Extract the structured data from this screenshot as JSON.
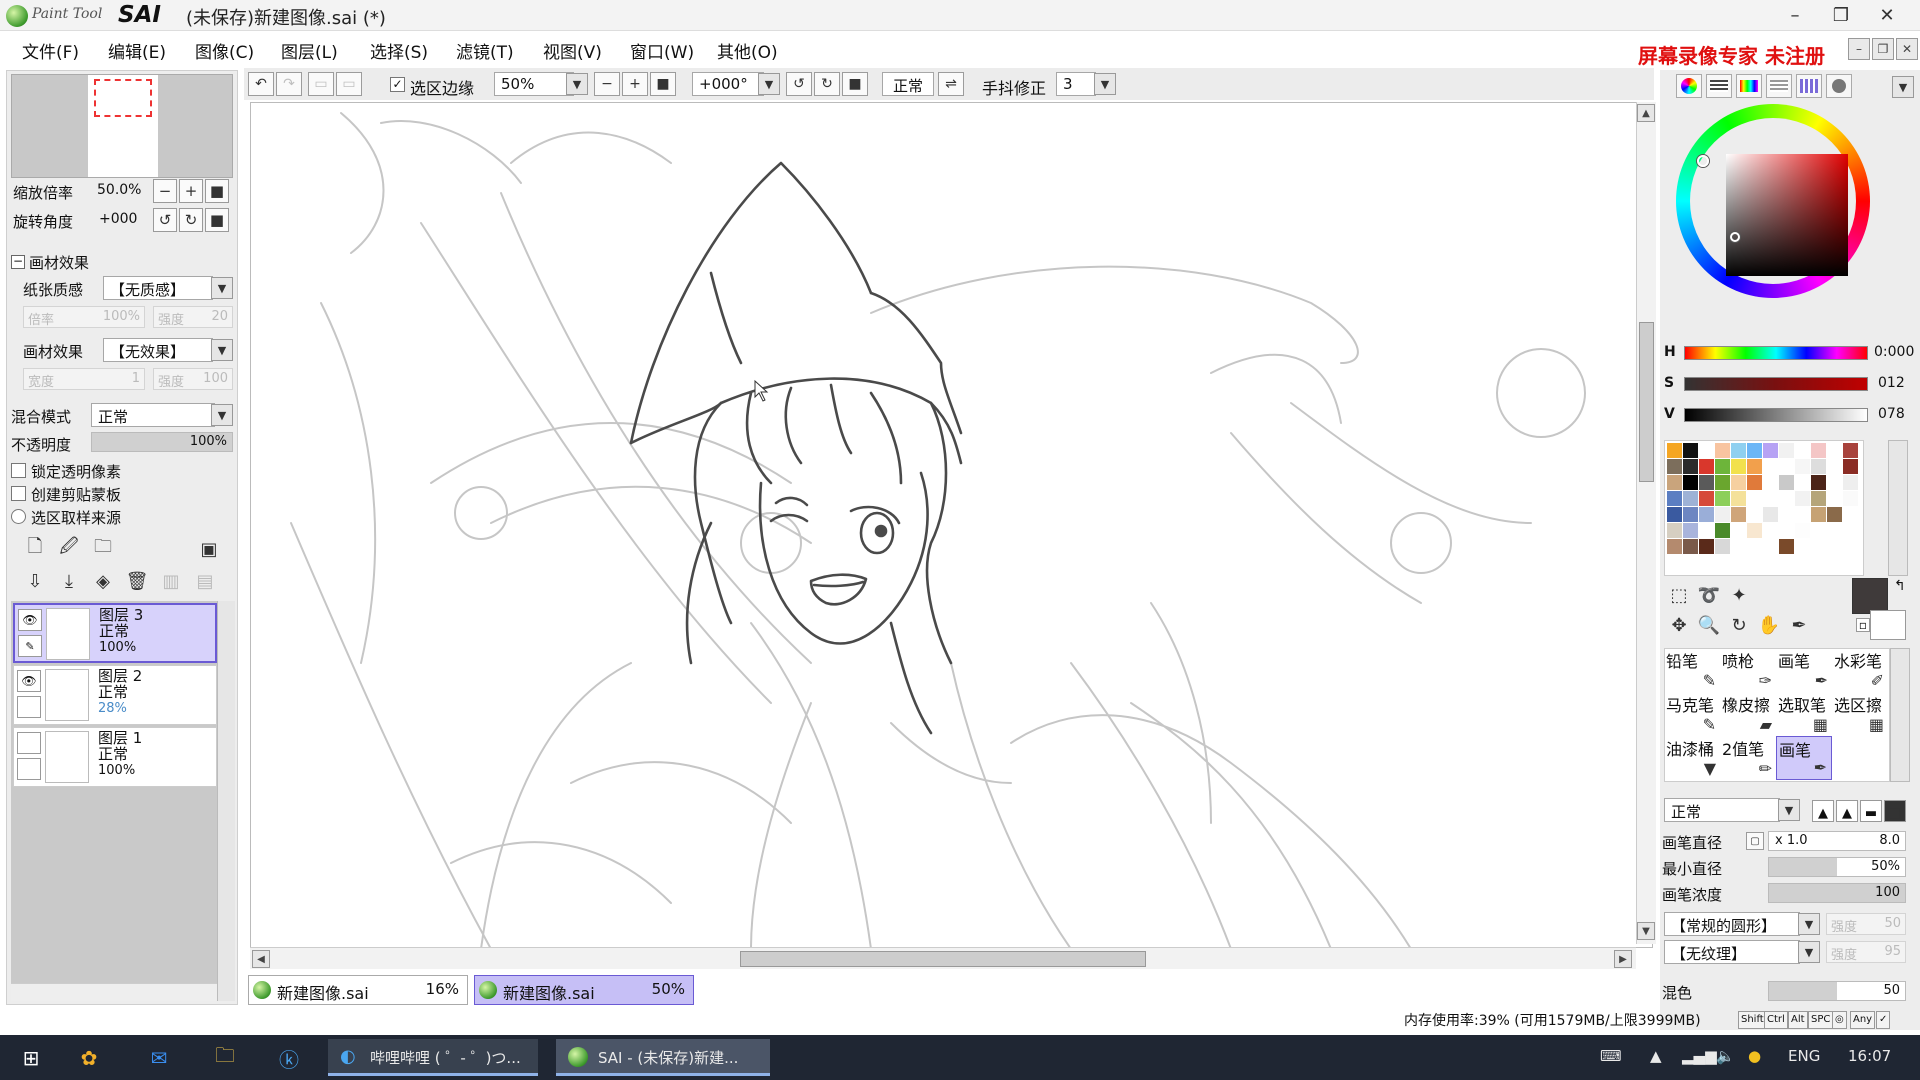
{
  "titlebar": {
    "logo_small": "Paint Tool",
    "logo_big": "SAI",
    "title": "(未保存)新建图像.sai (*)",
    "minimize_icon": "minimize-icon",
    "restore_icon": "restore-icon",
    "close_icon": "close-icon"
  },
  "menu": [
    "文件(F)",
    "编辑(E)",
    "图像(C)",
    "图层(L)",
    "选择(S)",
    "滤镜(T)",
    "视图(V)",
    "窗口(W)",
    "其他(O)"
  ],
  "watermark": "屏幕录像专家 未注册",
  "navigator": {
    "zoom_label": "缩放倍率",
    "zoom_value": "50.0%",
    "rotate_label": "旋转角度",
    "rotate_value": "+000"
  },
  "texture": {
    "section_label": "画材效果",
    "paper_label": "纸张质感",
    "paper_value": "【无质感】",
    "scale_label": "倍率",
    "scale_value": "100%",
    "strength_label": "强度",
    "strength_value": "20",
    "effect_label": "画材效果",
    "effect_value": "【无效果】",
    "width_label": "宽度",
    "width_value": "1",
    "strength2_label": "强度",
    "strength2_value": "100"
  },
  "layer_props": {
    "blend_label": "混合模式",
    "blend_value": "正常",
    "opacity_label": "不透明度",
    "opacity_value": "100%",
    "opacity_fraction": 1.0,
    "lock_transparency": "锁定透明像素",
    "clipping_group": "创建剪贴蒙板",
    "selection_source": "选区取样来源"
  },
  "layers": [
    {
      "name": "图层 3",
      "mode": "正常",
      "opacity": "100%",
      "visible": true,
      "selected": true
    },
    {
      "name": "图层 2",
      "mode": "正常",
      "opacity": "28%",
      "visible": true,
      "selected": false
    },
    {
      "name": "图层 1",
      "mode": "正常",
      "opacity": "100%",
      "visible": false,
      "selected": false
    }
  ],
  "toolbar": {
    "show_selection": "选区边缘",
    "zoom": "50%",
    "rotation": "+000°",
    "blend": "正常",
    "stabilizer_label": "手抖修正",
    "stabilizer_value": "3"
  },
  "doc_tabs": [
    {
      "name": "新建图像.sai",
      "zoom": "16%",
      "active": false
    },
    {
      "name": "新建图像.sai",
      "zoom": "50%",
      "active": true
    }
  ],
  "color": {
    "h_label": "H",
    "h_value": "0:000",
    "s_label": "S",
    "s_value": "012",
    "v_label": "V",
    "v_value": "078",
    "primary_color": "#3f3a3a",
    "secondary_color": "#ffffff"
  },
  "swatches": [
    "#f5a623",
    "#111111",
    "#ffffff",
    "#f8c4a0",
    "#8fd0f0",
    "#6cb6f6",
    "#b6a2f4",
    "#f1f1f1",
    "#ffffff",
    "#f4c6c6",
    "#ffffff",
    "#a8423c",
    "#7c6e5c",
    "#2b2b2b",
    "#d9372c",
    "#6db53a",
    "#f2e14d",
    "#f2a04c",
    "#ffffff",
    "#ffffff",
    "#f6f6f6",
    "#dddddd",
    "#ffffff",
    "#8a2c24",
    "#c9a47c",
    "#000000",
    "#5a5a5a",
    "#6aa62e",
    "#f6d0a0",
    "#e07a3a",
    "#ffffff",
    "#c9c9c9",
    "#ffffff",
    "#4c2418",
    "#ffffff",
    "#eeeeee",
    "#5b7ec2",
    "#9eb2d6",
    "#d64a3a",
    "#8ccf5a",
    "#f4e19a",
    "#ffffff",
    "#ffffff",
    "#ffffff",
    "#f2f2f2",
    "#b5a57a",
    "#ffffff",
    "#fafafa",
    "#3a5aa0",
    "#6d86c2",
    "#9aaed8",
    "#f0f0f0",
    "#cfa57a",
    "#ffffff",
    "#e8e8e8",
    "#ffffff",
    "#ffffff",
    "#c6a274",
    "#8a6a4a",
    "#ffffff",
    "#d6cfc2",
    "#a9b4dc",
    "#ffffff",
    "#4a8a2a",
    "#ffffff",
    "#f8e7d0",
    "#ffffff",
    "#ffffff",
    "#fdfdfd",
    "#ffffff",
    "#ffffff",
    "#ffffff",
    "#b48a6e",
    "#7a5a4a",
    "#5a2a1a",
    "#d8d8d8",
    "#ffffff",
    "#ffffff",
    "#ffffff",
    "#7a4a2a",
    "#ffffff",
    "#ffffff",
    "#ffffff",
    "#ffffff"
  ],
  "brushes": [
    {
      "name": "铅笔",
      "icon": "✎",
      "selected": false
    },
    {
      "name": "喷枪",
      "icon": "✑",
      "selected": false
    },
    {
      "name": "画笔",
      "icon": "✒",
      "selected": false
    },
    {
      "name": "水彩笔",
      "icon": "✐",
      "selected": false
    },
    {
      "name": "马克笔",
      "icon": "✎",
      "selected": false
    },
    {
      "name": "橡皮擦",
      "icon": "▰",
      "selected": false
    },
    {
      "name": "选取笔",
      "icon": "▦",
      "selected": false
    },
    {
      "name": "选区擦",
      "icon": "▦",
      "selected": false
    },
    {
      "name": "油漆桶",
      "icon": "▼",
      "selected": false
    },
    {
      "name": "2值笔",
      "icon": "✏",
      "selected": false
    },
    {
      "name": "画笔",
      "icon": "✒",
      "selected": true
    }
  ],
  "brush_settings": {
    "blend_value": "正常",
    "size_label": "画笔直径",
    "size_multiplier": "x 1.0",
    "size_value": "8.0",
    "min_size_label": "最小直径",
    "min_size_value": "50%",
    "density_label": "画笔浓度",
    "density_value": "100",
    "shape_value": "【常规的圆形】",
    "shape_strength_label": "强度",
    "shape_strength_value": "50",
    "texture_value": "【无纹理】",
    "texture_strength_label": "强度",
    "texture_strength_value": "95",
    "blending_label": "混色",
    "blending_value": "50"
  },
  "status": {
    "memory": "内存使用率:39% (可用1579MB/上限3999MB)",
    "keys": [
      "Shift",
      "Ctrl",
      "Alt",
      "SPC",
      "◎",
      "Any",
      "✓"
    ]
  },
  "taskbar": {
    "apps": [
      {
        "label": "哔哩哔哩 ( ゜- ゜)つ...",
        "active": false
      },
      {
        "label": "SAI - (未保存)新建...",
        "active": true
      }
    ],
    "lang": "ENG",
    "time": "16:07"
  }
}
